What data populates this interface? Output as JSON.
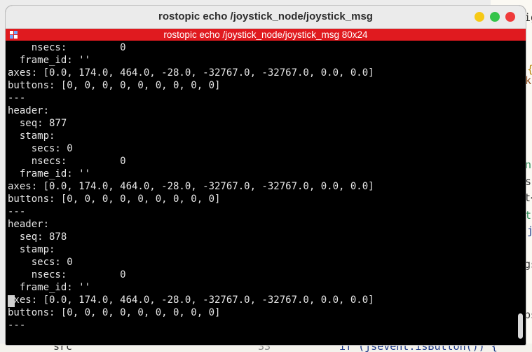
{
  "window": {
    "title": "rostopic echo /joystick_node/joystick_msg",
    "tab_title": "rostopic echo /joystick_node/joystick_msg 80x24"
  },
  "terminal": {
    "lines": [
      "    nsecs:         0",
      "  frame_id: ''",
      "axes: [0.0, 174.0, 464.0, -28.0, -32767.0, -32767.0, 0.0, 0.0]",
      "buttons: [0, 0, 0, 0, 0, 0, 0, 0, 0]",
      "---",
      "header:",
      "  seq: 877",
      "  stamp:",
      "    secs: 0",
      "    nsecs:         0",
      "  frame_id: ''",
      "axes: [0.0, 174.0, 464.0, -28.0, -32767.0, -32767.0, 0.0, 0.0]",
      "buttons: [0, 0, 0, 0, 0, 0, 0, 0, 0]",
      "---",
      "header:",
      "  seq: 878",
      "  stamp:",
      "    secs: 0",
      "    nsecs:         0",
      "  frame_id: ''",
      "axes: [0.0, 174.0, 464.0, -28.0, -32767.0, -32767.0, 0.0, 0.0]",
      "buttons: [0, 0, 0, 0, 0, 0, 0, 0, 0]",
      "---"
    ]
  },
  "background_editor": {
    "fragments": [
      {
        "text": "ig",
        "color": "#333333"
      },
      {
        "text": "{",
        "color": "#b8860b"
      },
      {
        "text": "tk",
        "color": "#8b4513"
      },
      {
        "text": "k",
        "color": "#333333"
      },
      {
        "text": "k",
        "color": "#333333"
      },
      {
        "text": "en",
        "color": "#2e8b57"
      },
      {
        "text": "ns",
        "color": "#333333"
      },
      {
        "text": "t<",
        "color": "#333333"
      },
      {
        "text": "ct",
        "color": "#2e8b57"
      },
      {
        "text": "j",
        "color": "#1e3a8a"
      },
      {
        "text": "gs",
        "color": "#333333"
      },
      {
        "text": "ps",
        "color": "#333333"
      }
    ],
    "bottom_left": "src",
    "line_number": "33",
    "code": "if (jsevent.isButton()) {"
  }
}
